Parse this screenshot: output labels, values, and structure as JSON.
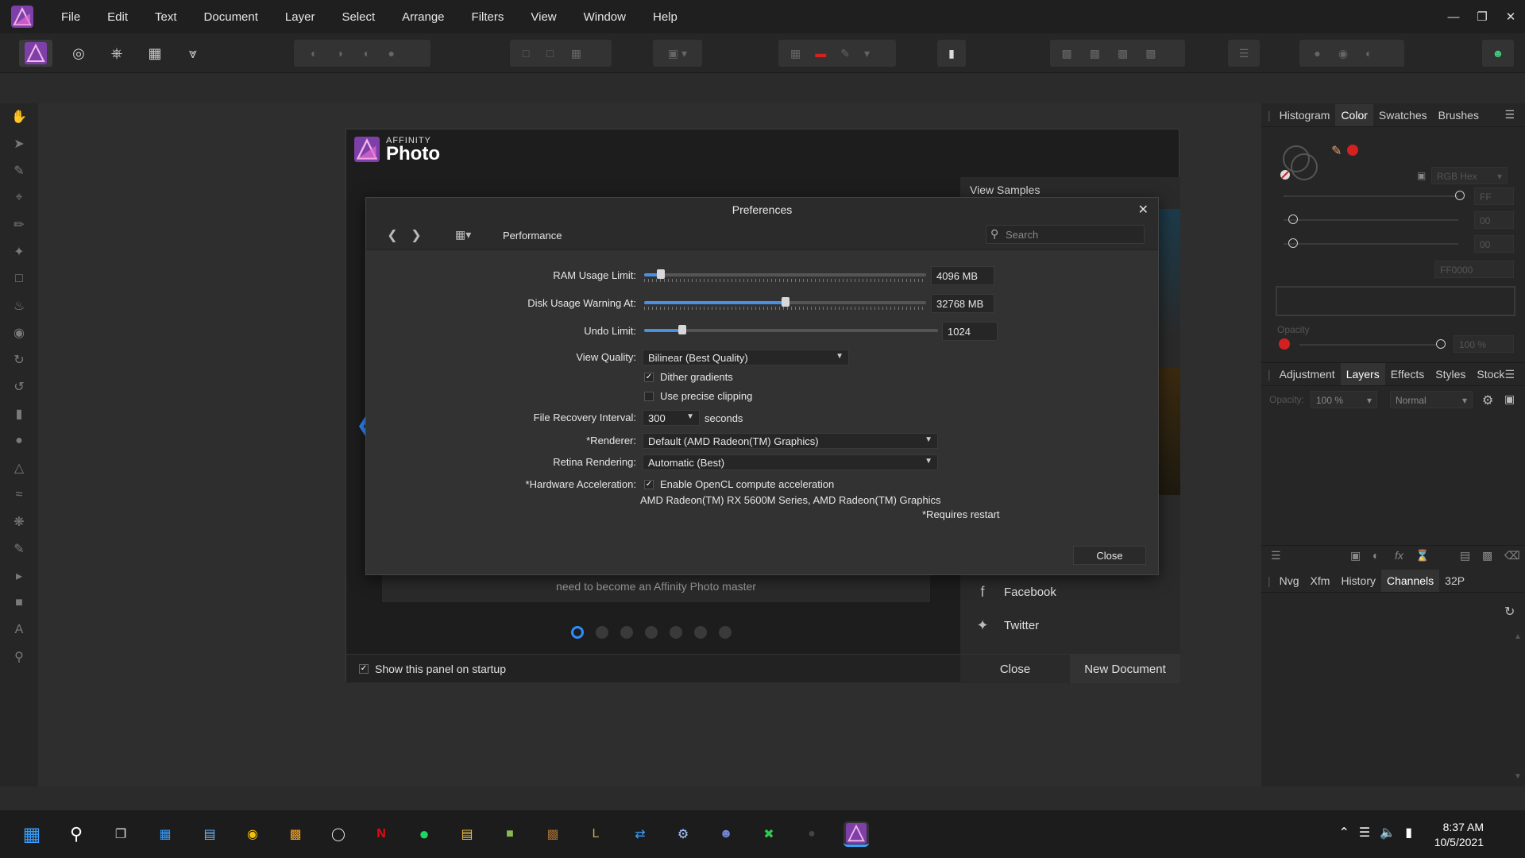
{
  "menubar": {
    "items": [
      "File",
      "Edit",
      "Text",
      "Document",
      "Layer",
      "Select",
      "Arrange",
      "Filters",
      "View",
      "Window",
      "Help"
    ],
    "window_controls": [
      "minimize",
      "restore",
      "close"
    ]
  },
  "welcome": {
    "brand_small": "AFFINITY",
    "brand_large": "Photo",
    "view_samples": "View Samples",
    "caption": "need to become an Affinity Photo master",
    "facebook": "Facebook",
    "twitter": "Twitter",
    "show_on_startup": "Show this panel on startup",
    "close": "Close",
    "new_document": "New Document"
  },
  "prefs": {
    "title": "Preferences",
    "section": "Performance",
    "search_placeholder": "Search",
    "ram_label": "RAM Usage Limit:",
    "ram_value": "4096 MB",
    "ram_level": 0.06,
    "disk_label": "Disk Usage Warning At:",
    "disk_value": "32768 MB",
    "disk_level": 0.5,
    "undo_label": "Undo Limit:",
    "undo_value": "1024",
    "undo_level": 0.13,
    "view_quality_label": "View Quality:",
    "view_quality_value": "Bilinear (Best Quality)",
    "dither_label": "Dither gradients",
    "dither_checked": true,
    "precise_clip_label": "Use precise clipping",
    "precise_clip_checked": false,
    "recovery_label": "File Recovery Interval:",
    "recovery_value": "300",
    "recovery_unit": "seconds",
    "renderer_label": "*Renderer:",
    "renderer_value": "Default (AMD Radeon(TM) Graphics)",
    "retina_label": "Retina Rendering:",
    "retina_value": "Automatic (Best)",
    "hw_label": "*Hardware Acceleration:",
    "hw_checkbox_label": "Enable OpenCL compute acceleration",
    "hw_checked": true,
    "gpu_info": "AMD Radeon(TM) RX 5600M Series, AMD Radeon(TM) Graphics",
    "restart_note": "*Requires restart",
    "close": "Close"
  },
  "studio": {
    "top_tabs": [
      "Histogram",
      "Color",
      "Swatches",
      "Brushes"
    ],
    "top_active": "Color",
    "color_model": "RGB Hex",
    "r_value": "FF",
    "g_value": "00",
    "b_value": "00",
    "hex_value": "FF0000",
    "opacity_label": "Opacity",
    "opacity_value": "100 %",
    "accent_color": "#d42020",
    "mid_tabs": [
      "Adjustment",
      "Layers",
      "Effects",
      "Styles",
      "Stock"
    ],
    "mid_active": "Layers",
    "layers_opacity_label": "Opacity:",
    "layers_opacity": "100 %",
    "blend_mode": "Normal",
    "bottom_tabs": [
      "Nvg",
      "Xfm",
      "History",
      "Channels",
      "32P"
    ],
    "bottom_active": "Channels"
  },
  "taskbar": {
    "time": "8:37 AM",
    "date": "10/5/2021"
  }
}
